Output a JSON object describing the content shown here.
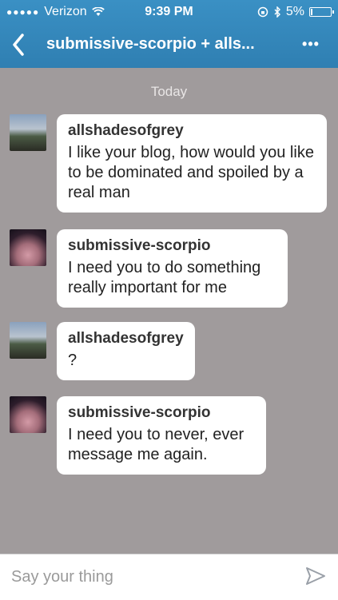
{
  "status_bar": {
    "carrier": "Verizon",
    "time": "9:39 PM",
    "battery": "5%",
    "battery_level": 0.05
  },
  "nav": {
    "title": "submissive-scorpio + alls...",
    "more_label": "•••"
  },
  "chat": {
    "date_label": "Today",
    "messages": [
      {
        "sender": "allshadesofgrey",
        "text": "I like your blog, how would you like to be dominated and spoiled by a real man"
      },
      {
        "sender": "submissive-scorpio",
        "text": "I need you to do something really important for me"
      },
      {
        "sender": "allshadesofgrey",
        "text": "?"
      },
      {
        "sender": "submissive-scorpio",
        "text": "I need you to never, ever message me again."
      }
    ]
  },
  "composer": {
    "placeholder": "Say your thing",
    "value": ""
  },
  "colors": {
    "header": "#3a90c4",
    "chat_background": "#a09b9c",
    "send_icon": "#9aa0a8"
  },
  "icons": {
    "back": "chevron-left-icon",
    "more": "more-dots-icon",
    "send": "send-arrow-icon",
    "wifi": "wifi-icon",
    "bluetooth": "bluetooth-icon",
    "lock": "rotation-lock-icon",
    "battery": "battery-icon"
  }
}
